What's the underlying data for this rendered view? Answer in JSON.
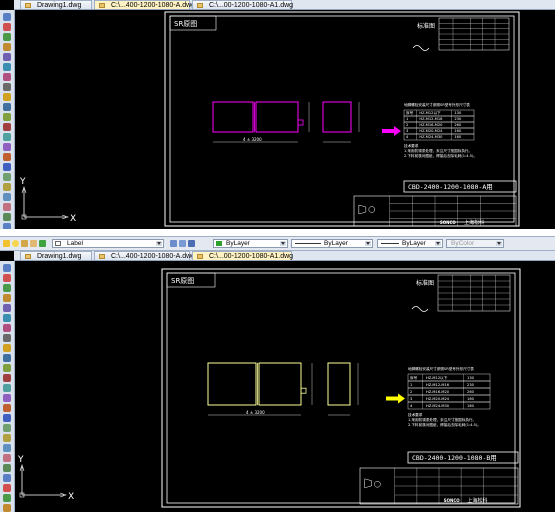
{
  "top": {
    "tabs": [
      {
        "label": "Drawing1.dwg"
      },
      {
        "label": "C:\\...400-1200-1080-A.dwg"
      },
      {
        "label": "C:\\...00-1200-1080-A1.dwg"
      }
    ],
    "active_tab": 1,
    "sheet": {
      "title_box": "SR原图",
      "std_label": "标准图",
      "dim_label": "4 ± 3200",
      "note_title": "地脚螺栓安装尺寸参照SR型号外形尺寸表",
      "table_rows": [
        [
          "序号",
          "HZ-M12以下",
          "130"
        ],
        [
          "1",
          "HZ-M12-M16",
          "230"
        ],
        [
          "2",
          "HZ-M16-M20",
          "260"
        ],
        [
          "3",
          "HZ-M20-M24",
          "160"
        ],
        [
          "4",
          "HZ-M24-M30",
          "160"
        ]
      ],
      "notes": "技术要求\n1.采用防锈漆处理，未注尺寸按国标执行。\n2.下料前核对图纸，焊接后去除毛刺(1:4.5)。",
      "model_code": "CBD-2400-1200-1080-A用",
      "company": "上海松科",
      "logo": "SONCO",
      "arrow_color": "#ff00ff",
      "line_color": "#ff00ff"
    },
    "ucs": {
      "y": "Y",
      "x": "X"
    }
  },
  "toolbar": {
    "layer": "Label",
    "color": "ByLayer",
    "linetype": "ByLayer",
    "lineweight": "ByLayer",
    "plotstyle": "ByColor"
  },
  "bottom": {
    "tabs": [
      {
        "label": "Drawing1.dwg"
      },
      {
        "label": "C:\\...400-1200-1080-A.dwg"
      },
      {
        "label": "C:\\...00-1200-1080-A1.dwg"
      }
    ],
    "active_tab": 2,
    "sheet": {
      "title_box": "SR原图",
      "std_label": "标准图",
      "dim_label": "4 ± 3200",
      "note_title": "地脚螺栓安装尺寸参照SR型号外形尺寸表",
      "table_rows": [
        [
          "序号",
          "HZ-M12以下",
          "130"
        ],
        [
          "1",
          "HZ-M12-M16",
          "230"
        ],
        [
          "2",
          "HZ-M16-M20",
          "260"
        ],
        [
          "3",
          "HZ-M20-M24",
          "160"
        ],
        [
          "4",
          "HZ-M24-M30",
          "160"
        ]
      ],
      "notes": "技术要求\n1.采用防锈漆处理，未注尺寸按国标执行。\n2.下料前核对图纸，焊接后去除毛刺(1:4.5)。",
      "model_code": "CBD-2400-1200-1080-B用",
      "company": "上海松科",
      "logo": "SONCO",
      "arrow_color": "#ffff00",
      "line_color": "#ffff99"
    },
    "ucs": {
      "y": "Y",
      "x": "X"
    }
  }
}
